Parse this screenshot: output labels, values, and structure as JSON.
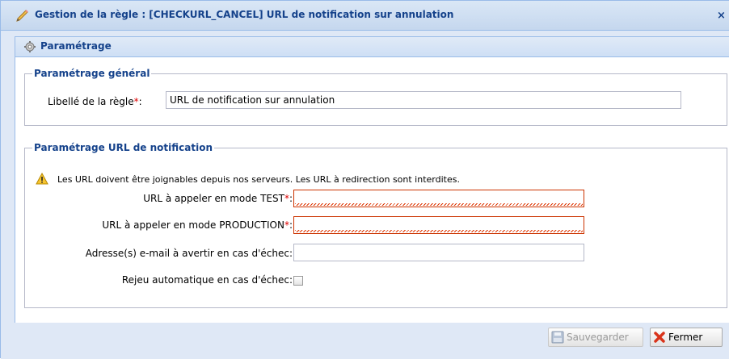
{
  "window": {
    "title": "Gestion de la règle : [CHECKURL_CANCEL] URL de notification sur annulation",
    "close_glyph": "×",
    "icon": "pencil-icon"
  },
  "panel": {
    "title": "Paramétrage",
    "icon": "gear-icon"
  },
  "general": {
    "legend": "Paramétrage général",
    "label_field": {
      "label": "Libellé de la règle",
      "required_mark": "*",
      "colon": ":",
      "value": "URL de notification sur annulation"
    }
  },
  "notification": {
    "legend": "Paramétrage URL de notification",
    "warning": "Les URL doivent être joignables depuis nos serveurs. Les URL à redirection sont interdites.",
    "test_url": {
      "label": "URL à appeler en mode TEST",
      "required_mark": "*",
      "colon": ":",
      "value": ""
    },
    "prod_url": {
      "label": "URL à appeler en mode PRODUCTION",
      "required_mark": "*",
      "colon": ":",
      "value": ""
    },
    "emails": {
      "label": "Adresse(s) e-mail à avertir en cas d'échec:",
      "value": ""
    },
    "replay": {
      "label": "Rejeu automatique en cas d'échec:",
      "checked": false
    }
  },
  "footer": {
    "save_label": "Sauvegarder",
    "close_label": "Fermer"
  },
  "colors": {
    "title_text": "#15428b",
    "border": "#99bbe8",
    "required": "#dd0000",
    "invalid_border": "#cc3300"
  }
}
